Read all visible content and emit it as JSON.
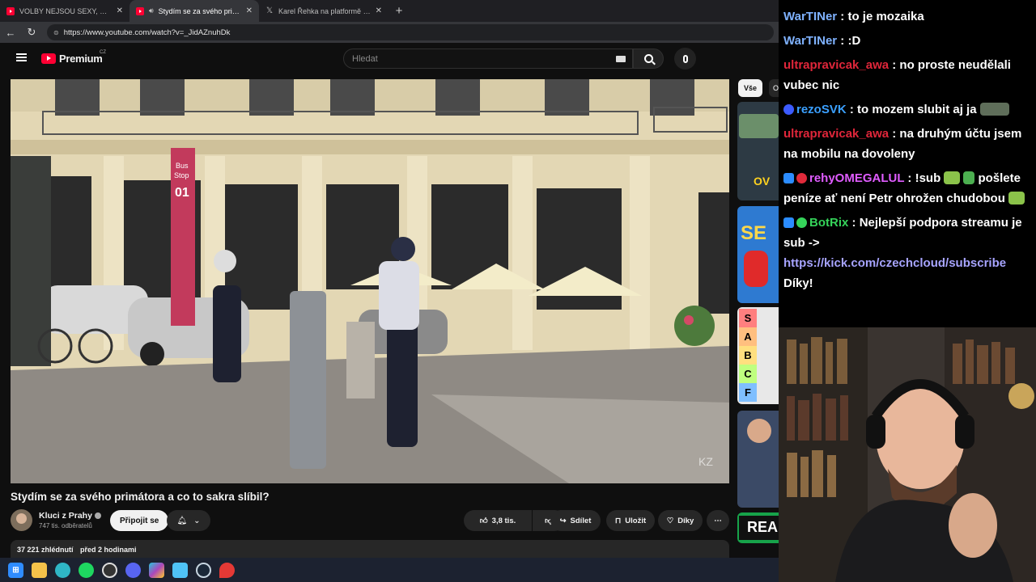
{
  "browser": {
    "tabs": [
      {
        "title": "VOLBY NEJSOU SEXY, Z NICH NEM",
        "favicon": "youtube-icon",
        "active": false
      },
      {
        "title": "Stydím se za svého primátora",
        "favicon": "youtube-icon",
        "active": true
      },
      {
        "title": "Karel Řehka na platformě X: „Po v",
        "favicon": "x-icon",
        "active": false
      }
    ],
    "url": "https://www.youtube.com/watch?v=_JidAZnuhDk"
  },
  "youtube": {
    "logo_text": "Premium",
    "logo_country": "CZ",
    "search_placeholder": "Hledat",
    "video": {
      "title": "Stydím se za svého primátora a co to sakra slíbil?",
      "watermark": "KZ",
      "scene_signs": {
        "stop_line1": "Bus",
        "stop_line2": "Stop",
        "stop_number": "01"
      }
    },
    "channel": {
      "name": "Kluci z Prahy",
      "subscribers": "747 tis. odběratelů"
    },
    "join_label": "Připojit se",
    "actions": {
      "likes": "3,8 tis.",
      "share": "Sdílet",
      "save": "Uložit",
      "thanks": "Díky"
    },
    "description": {
      "views": "37 221 zhlédnutí",
      "time": "před 2 hodinami"
    },
    "sidebar": {
      "chips": [
        "Vše",
        "O"
      ],
      "thumb_texts": [
        "OV",
        "SE",
        "REA"
      ],
      "tier_letters": [
        "S",
        "A",
        "B",
        "C",
        "F"
      ]
    }
  },
  "chat": {
    "messages": [
      {
        "user": "WarTINer",
        "color": "#7fb2ff",
        "text": "to je mozaika"
      },
      {
        "user": "WarTINer",
        "color": "#7fb2ff",
        "text": ":D"
      },
      {
        "user": "ultrapravicak_awa",
        "color": "#e0263a",
        "text": "no proste neudělali vubec nic"
      },
      {
        "user": "rezoSVK",
        "color": "#3ba0ff",
        "text": "to mozem slubit aj ja"
      },
      {
        "user": "ultrapravicak_awa",
        "color": "#e0263a",
        "text": "na druhým účtu jsem na mobilu na dovoleny"
      },
      {
        "user": "rehyOMEGALUL",
        "color": "#e05cff",
        "text": "!sub",
        "text2": "pošlete peníze ať není Petr ohrožen chudobou"
      },
      {
        "user": "BotRix",
        "color": "#35d35a",
        "text": "Nejlepší podpora streamu je sub ->",
        "link": "https://kick.com/czechcloud/subscribe",
        "text3": "Díky!"
      }
    ]
  },
  "taskbar": {
    "icons": [
      "windows-start-icon",
      "file-explorer-icon",
      "edge-icon",
      "spotify-icon",
      "obs-icon",
      "discord-icon",
      "copilot-icon",
      "notepad-icon",
      "steam-icon",
      "maps-icon"
    ]
  }
}
